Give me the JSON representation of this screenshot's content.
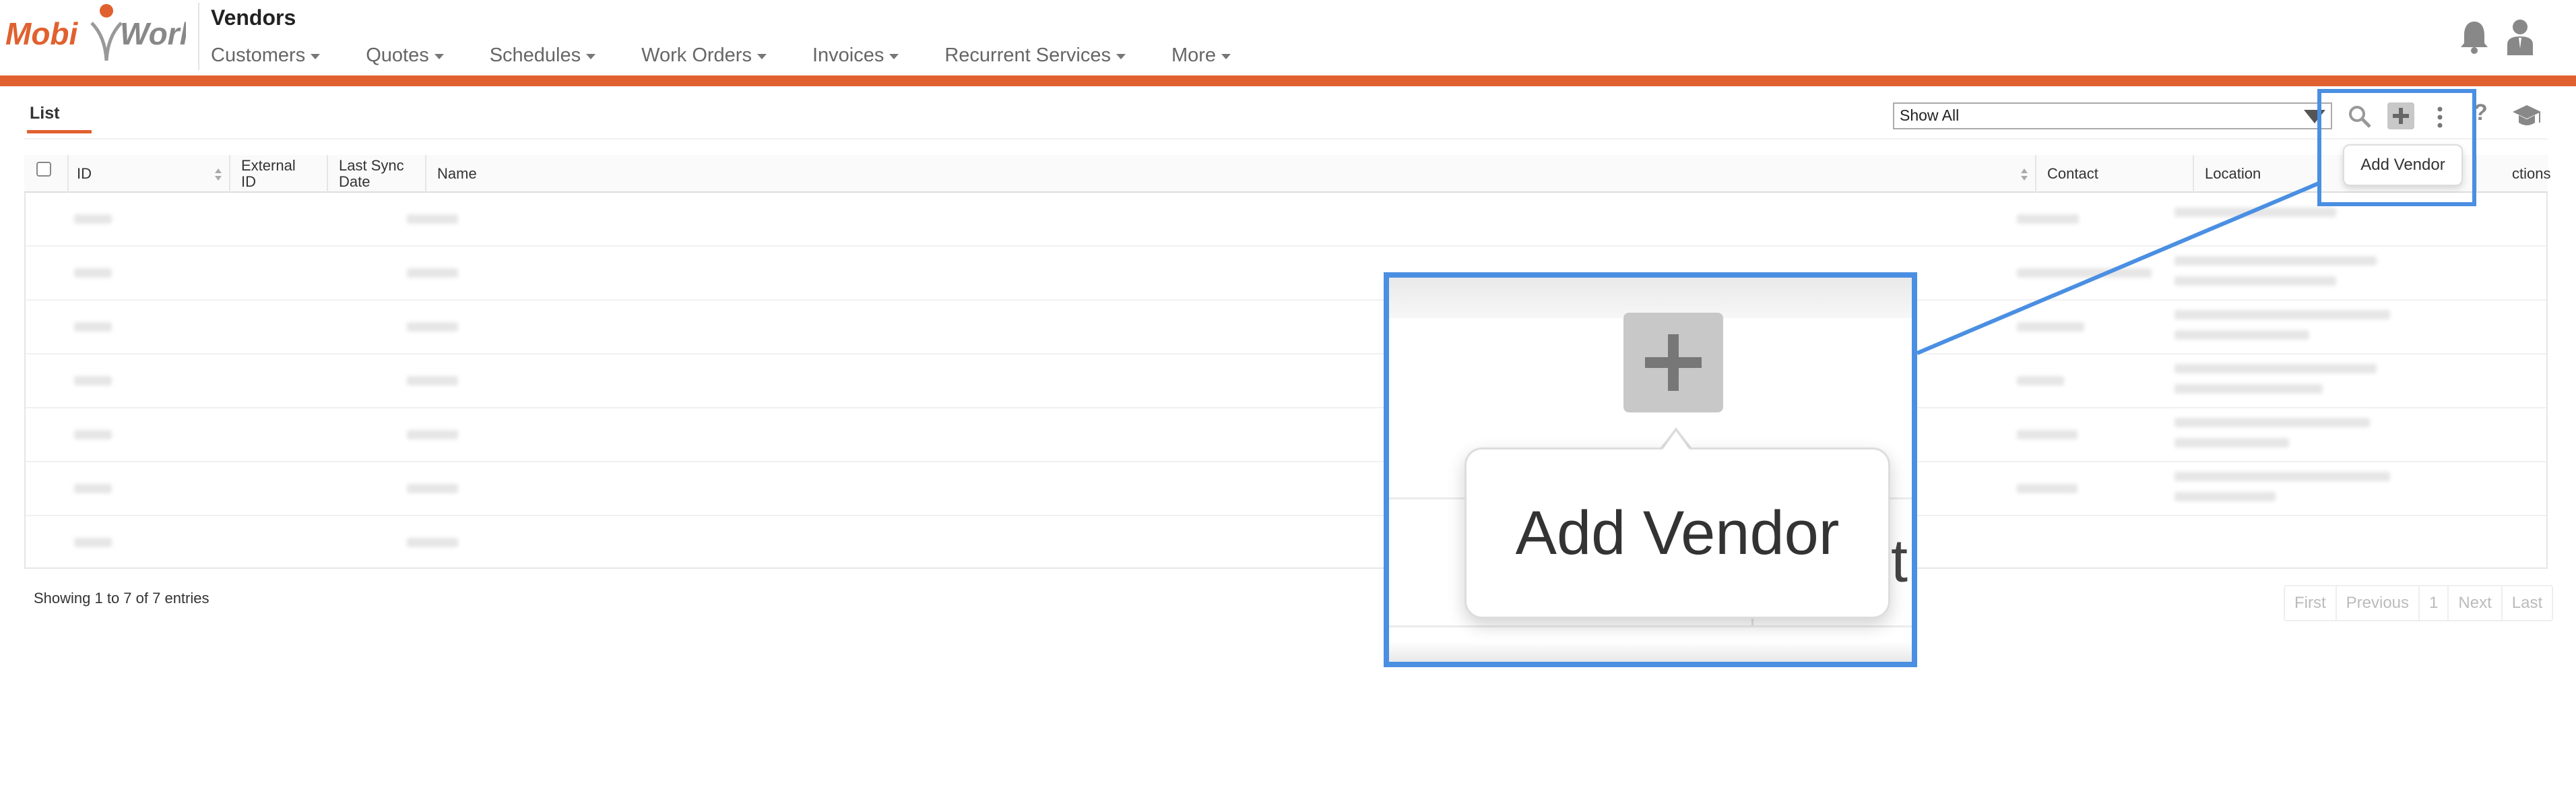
{
  "app": {
    "logo_text": "MobiWork",
    "page_title": "Vendors"
  },
  "nav": [
    {
      "label": "Customers"
    },
    {
      "label": "Quotes"
    },
    {
      "label": "Schedules"
    },
    {
      "label": "Work Orders"
    },
    {
      "label": "Invoices"
    },
    {
      "label": "Recurrent Services"
    },
    {
      "label": "More"
    }
  ],
  "tabs": {
    "list": "List"
  },
  "toolbar": {
    "filter_value": "Show All",
    "add_tooltip": "Add Vendor"
  },
  "table": {
    "columns": [
      "ID",
      "External ID",
      "Last Sync Date",
      "Name",
      "Contact",
      "Location",
      "Actions"
    ],
    "columns_display": [
      "ID",
      "External\nID",
      "Last Sync\nDate",
      "Name",
      "Contact",
      "Location",
      "ctions"
    ],
    "row_count": 7
  },
  "footer": {
    "info": "Showing 1 to 7 of 7 entries",
    "pagination": [
      "First",
      "Previous",
      "1",
      "Next",
      "Last"
    ]
  },
  "zoom": {
    "tooltip": "Add Vendor",
    "behind_text": "cti"
  },
  "colors": {
    "accent": "#e0612f",
    "highlight": "#4a8fe2"
  },
  "icons": [
    "bell-icon",
    "user-icon",
    "search-icon",
    "plus-icon",
    "kebab-icon",
    "help-icon",
    "graduation-cap-icon",
    "sort-icon",
    "caret-down-icon"
  ]
}
